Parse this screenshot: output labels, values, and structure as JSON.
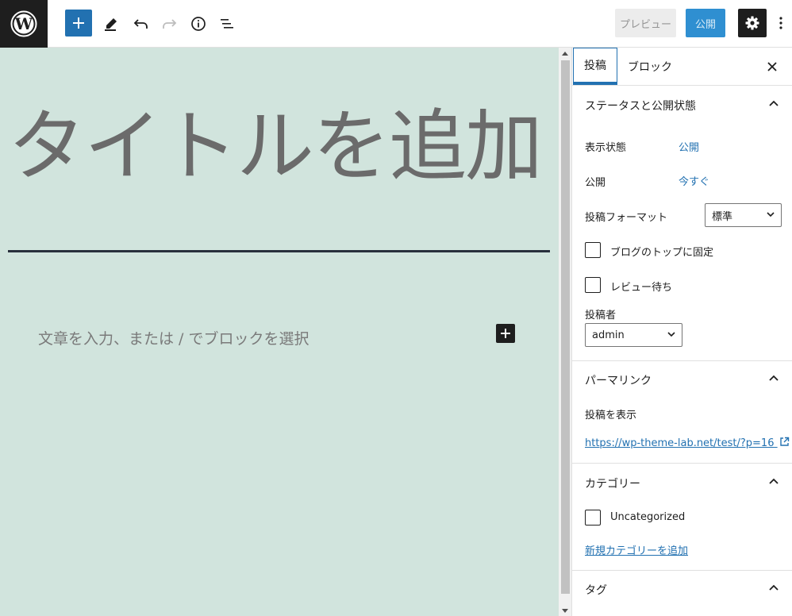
{
  "toolbar": {
    "preview_label": "プレビュー",
    "publish_label": "公開"
  },
  "editor": {
    "title_placeholder": "タイトルを追加",
    "paragraph_placeholder": "文章を入力、または / でブロックを選択"
  },
  "sidebar": {
    "tabs": [
      "投稿",
      "ブロック"
    ],
    "status_panel": {
      "title": "ステータスと公開状態",
      "visibility_label": "表示状態",
      "visibility_value": "公開",
      "publish_label": "公開",
      "publish_value": "今すぐ",
      "format_label": "投稿フォーマット",
      "format_value": "標準",
      "sticky_label": "ブログのトップに固定",
      "pending_label": "レビュー待ち",
      "author_label": "投稿者",
      "author_value": "admin"
    },
    "permalink_panel": {
      "title": "パーマリンク",
      "view_label": "投稿を表示",
      "url": "https://wp-theme-lab.net/test/?p=16"
    },
    "category_panel": {
      "title": "カテゴリー",
      "category": "Uncategorized",
      "add_link": "新規カテゴリーを追加"
    },
    "tag_panel": {
      "title": "タグ"
    }
  },
  "colors": {
    "accent": "#2271b1",
    "canvas_bg": "#d1e4dd",
    "dark": "#1e1e1e"
  }
}
